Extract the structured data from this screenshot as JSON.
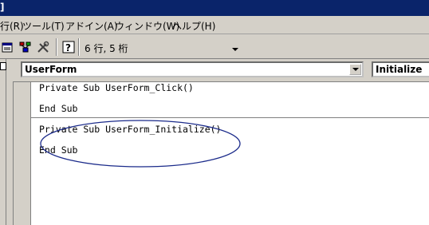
{
  "window": {
    "title": "]"
  },
  "menu": {
    "items": [
      {
        "label": "行(R)"
      },
      {
        "label": "ツール(T)"
      },
      {
        "label": "アドイン(A)"
      },
      {
        "label": "ウィンドウ(W)"
      },
      {
        "label": "ヘルプ(H)"
      }
    ]
  },
  "toolbar": {
    "icons": [
      "properties-icon",
      "object-browser-icon",
      "toolbox-icon",
      "help-icon"
    ],
    "cursor_position": "6 行, 5 桁"
  },
  "code_window": {
    "object_combo_value": "UserForm",
    "procedure_combo_value": "Initialize",
    "code_lines": [
      "Private Sub UserForm_Click()",
      "End Sub",
      "Private Sub UserForm_Initialize()",
      "End Sub"
    ]
  },
  "annotation": {
    "shape": "ellipse",
    "color": "#1a2a8a"
  }
}
